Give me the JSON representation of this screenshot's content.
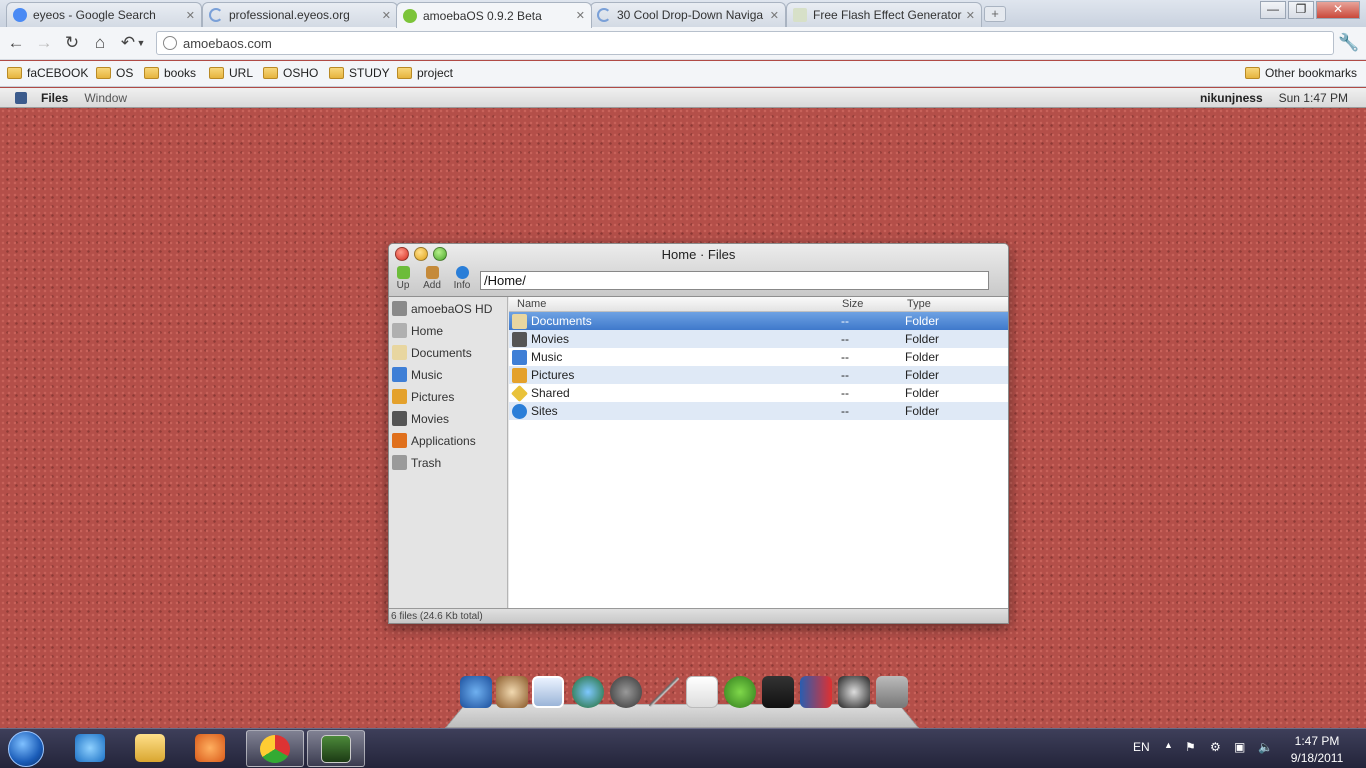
{
  "browser": {
    "tabs": [
      {
        "label": "eyeos - Google Search",
        "icon": "google-icon"
      },
      {
        "label": "professional.eyeos.org",
        "icon": "loading-icon"
      },
      {
        "label": "amoebaOS 0.9.2 Beta",
        "icon": "amoeba-icon"
      },
      {
        "label": "30 Cool Drop-Down Naviga",
        "icon": "loading-icon"
      },
      {
        "label": "Free Flash Effect Generator",
        "icon": "page-icon"
      }
    ],
    "new_tab": "+",
    "address": "amoebaos.com",
    "window_buttons": {
      "minimize": "—",
      "maximize": "❐",
      "close": "✕"
    },
    "bookmarks": [
      "faCEBOOK",
      "OS",
      "books",
      "URL",
      "OSHO",
      "STUDY",
      "project"
    ],
    "other_bookmarks": "Other bookmarks"
  },
  "amoeba": {
    "menu": [
      "Files",
      "Window"
    ],
    "user": "nikunjness",
    "time": "Sun 1:47 PM"
  },
  "files_window": {
    "title": "Home · Files",
    "tools": [
      "Up",
      "Add",
      "Info"
    ],
    "path": "/Home/",
    "sidebar": [
      "amoebaOS HD",
      "Home",
      "Documents",
      "Music",
      "Pictures",
      "Movies",
      "Applications",
      "Trash"
    ],
    "columns": {
      "name": "Name",
      "size": "Size",
      "type": "Type"
    },
    "rows": [
      {
        "name": "Documents",
        "size": "--",
        "type": "Folder"
      },
      {
        "name": "Movies",
        "size": "--",
        "type": "Folder"
      },
      {
        "name": "Music",
        "size": "--",
        "type": "Folder"
      },
      {
        "name": "Pictures",
        "size": "--",
        "type": "Folder"
      },
      {
        "name": "Shared",
        "size": "--",
        "type": "Folder"
      },
      {
        "name": "Sites",
        "size": "--",
        "type": "Folder"
      }
    ],
    "status": "6 files (24.6 Kb total)"
  },
  "dock_icons": [
    "globe-icon",
    "coffee-icon",
    "window-icon",
    "earth-icon",
    "headphones-icon",
    "pen-icon",
    "mail-icon",
    "bird-icon",
    "chart-icon",
    "book-icon",
    "hat-icon",
    "trash-icon"
  ],
  "taskbar": {
    "language": "EN",
    "time": "1:47 PM",
    "date": "9/18/2011"
  },
  "colors": {
    "selection": "#3f79cb",
    "alt_row": "#dfe9f6",
    "desktop": "#b44f49"
  }
}
